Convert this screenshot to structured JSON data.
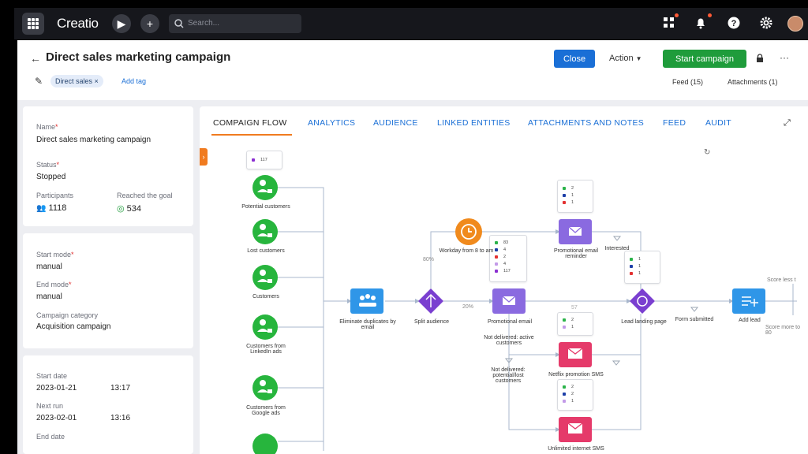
{
  "app": {
    "logo": "Creatio",
    "search_placeholder": "Search..."
  },
  "header": {
    "title": "Direct sales marketing campaign",
    "close_label": "Close",
    "action_label": "Action",
    "start_label": "Start campaign",
    "tag": "Direct sales",
    "add_tag": "Add tag",
    "feed": "Feed (15)",
    "attachments": "Attachments (1)"
  },
  "details": {
    "name_label": "Name",
    "name_value": "Direct sales marketing campaign",
    "status_label": "Status",
    "status_value": "Stopped",
    "participants_label": "Participants",
    "participants_value": "1118",
    "goal_label": "Reached the goal",
    "goal_value": "534",
    "start_mode_label": "Start mode",
    "start_mode_value": "manual",
    "end_mode_label": "End mode",
    "end_mode_value": "manual",
    "category_label": "Campaign category",
    "category_value": "Acquisition campaign",
    "start_date_label": "Start date",
    "start_date_value": "2023-01-21",
    "start_time_value": "13:17",
    "next_run_label": "Next run",
    "next_run_value": "2023-02-01",
    "next_run_time": "13:16",
    "end_date_label": "End date"
  },
  "tabs": [
    "COMPAIGN FLOW",
    "ANALYTICS",
    "AUDIENCE",
    "LINKED ENTITIES",
    "ATTACHMENTS AND NOTES",
    "FEED",
    "AUDIT"
  ],
  "flow": {
    "nodes": {
      "potential": "Potential customers",
      "lost": "Lost customers",
      "customers": "Customers",
      "linkedin": "Customers from LinkedIn ads",
      "google": "Customers from Google ads",
      "dedupe": "Eliminate duplicates by email",
      "split": "Split audience",
      "timer": "Workday from 8 to am",
      "promo": "Promotional email",
      "reminder": "Promotional email reminder",
      "landing": "Lead landing page",
      "addlead": "Add lead",
      "netflix": "Netflix promotion SMS",
      "unlimited": "Unlimited internet SMS"
    },
    "conditions": {
      "interested": "Interested",
      "form": "Form submitted",
      "not_active": "Not delivered: active customers",
      "not_potential": "Not delivered: potential/lost customers",
      "score_less": "Score less t",
      "score_more": "Score more to 80"
    },
    "percent_80": "80%",
    "percent_20": "20%",
    "count_57": "57",
    "sms_label": "SMS",
    "stats": {
      "top": [
        "117"
      ],
      "promo": [
        "83",
        "4",
        "2",
        "4",
        "117"
      ],
      "reminder": [
        "2",
        "1",
        "1"
      ],
      "landing": [
        "1",
        "1",
        "1"
      ],
      "netflix": [
        "2",
        "1"
      ],
      "unlimited": [
        "2",
        "2",
        "1"
      ]
    }
  },
  "colors": {
    "accent": "#1a6fd6",
    "start": "#1f9c3b",
    "active_tab": "#f07b20",
    "green_node": "#27b53d",
    "purple_node": "#8a6ae0",
    "red_node": "#e53a6a",
    "orange_node": "#f08a1d",
    "blue_node": "#2f96e8"
  }
}
